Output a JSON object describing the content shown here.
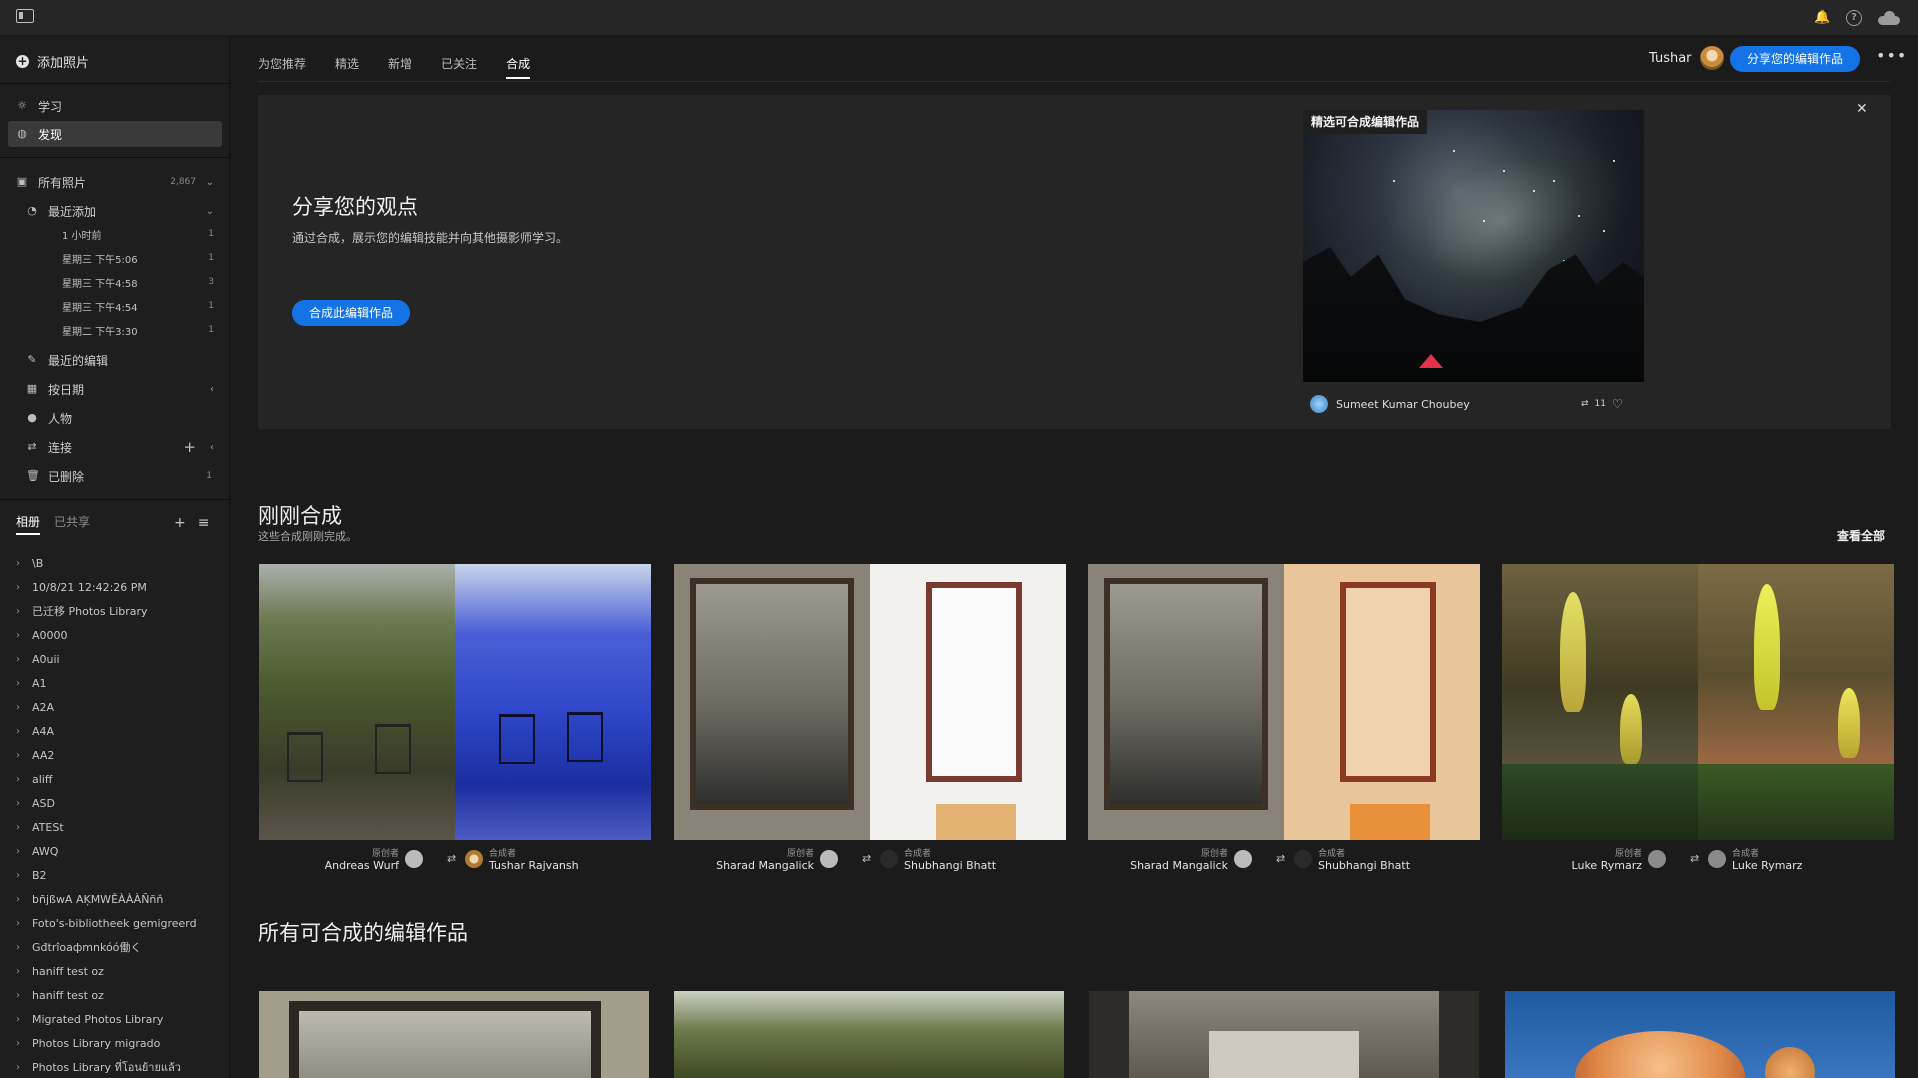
{
  "sidebar": {
    "add_photos": "添加照片",
    "learn": "学习",
    "discover": "发现",
    "all_photos": "所有照片",
    "all_photos_count": "2,867",
    "recently_added": "最近添加",
    "recent_sub": [
      {
        "label": "1 小时前",
        "count": "1"
      },
      {
        "label": "星期三 下午5:06",
        "count": "1"
      },
      {
        "label": "星期三 下午4:58",
        "count": "3"
      },
      {
        "label": "星期三 下午4:54",
        "count": "1"
      },
      {
        "label": "星期二 下午3:30",
        "count": "1"
      }
    ],
    "recent_edits": "最近的编辑",
    "by_date": "按日期",
    "people": "人物",
    "connect": "连接",
    "deleted": "已删除",
    "deleted_count": "1",
    "album_tab": "相册",
    "shared_tab": "已共享",
    "albums": [
      "\\B",
      "10/8/21 12:42:26 PM",
      "已迁移 Photos Library",
      "A0000",
      "A0uii",
      "A1",
      "A2A",
      "A4A",
      "AA2",
      "aliff",
      "ASD",
      "ATESt",
      "AWQ",
      "B2",
      "bñjßwA AĶMWĒÀÀÀÑñň",
      "Foto's-bibliotheek gemigreerd",
      "Gđtrîoaфmnkóó働く",
      "haniff test oz",
      "haniff test oz",
      "Migrated Photos Library",
      "Photos Library migrado",
      "Photos Library ที่โอนย้ายแล้ว"
    ]
  },
  "nav": {
    "tabs": [
      "为您推荐",
      "精选",
      "新增",
      "已关注",
      "合成"
    ],
    "active_index": 4,
    "username": "Tushar",
    "share_button": "分享您的编辑作品"
  },
  "banner": {
    "title": "分享您的观点",
    "description": "通过合成，展示您的编辑技能并向其他摄影师学习。",
    "button": "合成此编辑作品",
    "featured_label": "精选可合成编辑作品",
    "featured_author": "Sumeet Kumar Choubey",
    "remix_count": "11"
  },
  "just_remixed": {
    "title": "刚刚合成",
    "subtitle": "这些合成刚刚完成。",
    "see_all": "查看全部",
    "original_label": "原创者",
    "remixer_label": "合成者",
    "cards": [
      {
        "original": "Andreas Wurf",
        "remixer": "Tushar Rajvansh"
      },
      {
        "original": "Sharad Mangalick",
        "remixer": "Shubhangi Bhatt"
      },
      {
        "original": "Sharad Mangalick",
        "remixer": "Shubhangi Bhatt"
      },
      {
        "original": "Luke Rymarz",
        "remixer": "Luke Rymarz"
      }
    ]
  },
  "all_remixable": {
    "title": "所有可合成的编辑作品"
  },
  "colors": {
    "accent": "#1473e6",
    "background": "#1b1b1b",
    "sidebar": "#1e1e1e"
  }
}
